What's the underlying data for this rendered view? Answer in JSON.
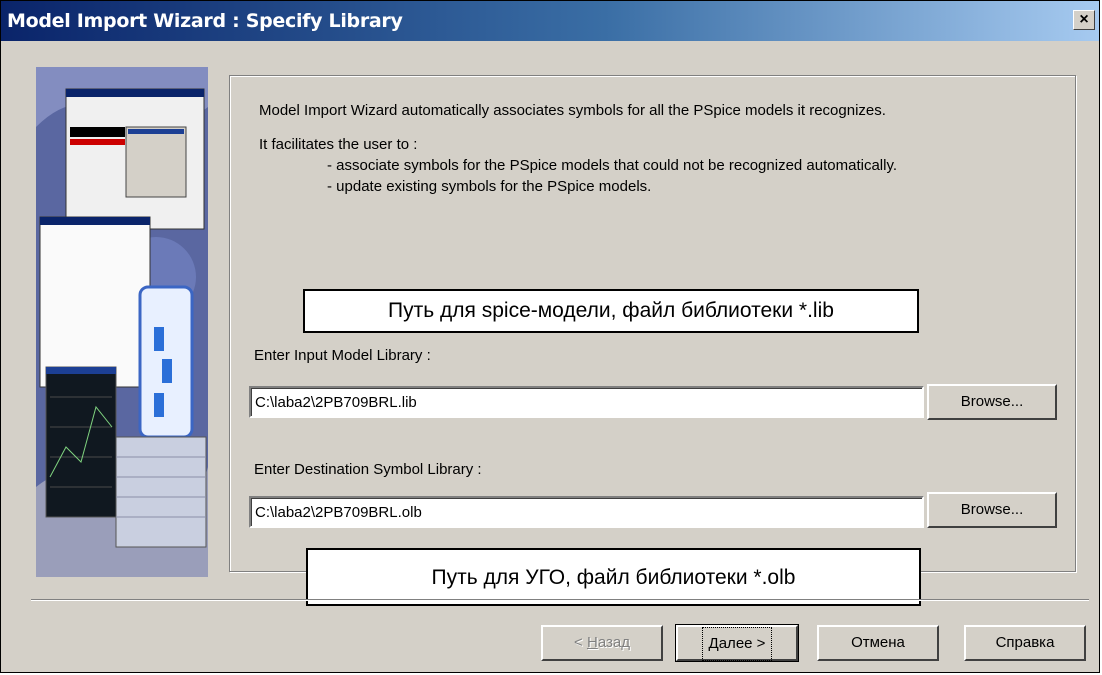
{
  "window": {
    "title": "Model Import Wizard : Specify Library",
    "close_glyph": "×"
  },
  "intro": {
    "line1": "Model Import Wizard automatically associates symbols for all the PSpice models it recognizes.",
    "line2": "It facilitates the user to :",
    "bullet1": "- associate symbols for the PSpice models that could not be recognized automatically.",
    "bullet2": "- update existing symbols for the PSpice models."
  },
  "annotations": {
    "spice": "Путь для spice-модели, файл библиотеки *.lib",
    "ugo": "Путь для УГО, файл библиотеки *.olb"
  },
  "input_library": {
    "label": "Enter Input Model Library :",
    "value": "C:\\laba2\\2PB709BRL.lib",
    "browse": "Browse..."
  },
  "destination_library": {
    "label": "Enter Destination Symbol Library :",
    "value": "C:\\laba2\\2PB709BRL.olb",
    "browse": "Browse..."
  },
  "buttons": {
    "back_prefix": "< ",
    "back_key": "Н",
    "back_rest": "азад",
    "next_key": "Д",
    "next_rest": "алее >",
    "cancel": "Отмена",
    "help": "Справка"
  },
  "colors": {
    "titlebar_start": "#0a246a",
    "face": "#d4d0c8"
  }
}
